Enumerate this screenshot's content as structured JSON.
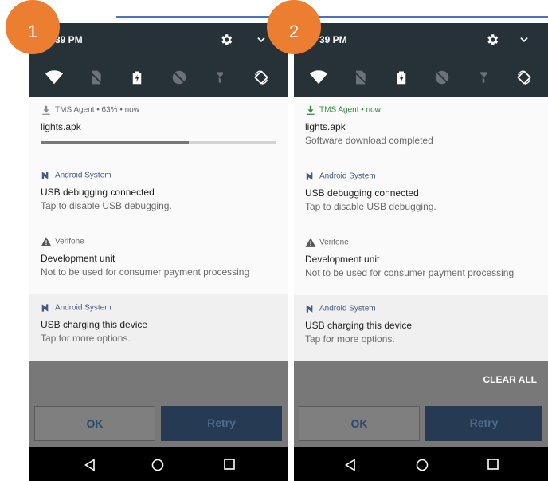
{
  "colors": {
    "statusbar": "#263238",
    "badge": "#ec7e32",
    "notification_bg": "#fafafa",
    "scrim": "#787878",
    "retry_button": "#263a53",
    "tms_download_green": "#2e8b3a"
  },
  "panels": [
    {
      "badge": "1",
      "status_time": "39 PM",
      "quick_settings_icons": [
        "wifi-icon",
        "sim-off-icon",
        "battery-icon",
        "data-saver-icon",
        "flashlight-off-icon",
        "auto-rotate-icon"
      ],
      "notifications": [
        {
          "app_icon": "download-icon",
          "app_line": "TMS Agent • 63% • now",
          "title": "lights.apk",
          "progress_percent": 63
        },
        {
          "app_icon": "android-n-icon",
          "app_line": "Android System",
          "title": "USB debugging connected",
          "subtitle": "Tap to disable USB debugging."
        },
        {
          "app_icon": "warning-icon",
          "app_line": "Verifone",
          "title": "Development unit",
          "subtitle": "Not to be used for consumer payment processing"
        },
        {
          "app_icon": "android-n-icon",
          "app_line": "Android System",
          "title": "USB charging this device",
          "subtitle": "Tap for more options."
        }
      ],
      "buttons": {
        "ok": "OK",
        "retry": "Retry"
      }
    },
    {
      "badge": "2",
      "status_time": "39 PM",
      "quick_settings_icons": [
        "wifi-icon",
        "sim-off-icon",
        "battery-icon",
        "data-saver-icon",
        "flashlight-off-icon",
        "auto-rotate-icon"
      ],
      "notifications": [
        {
          "app_icon": "download-icon",
          "app_line": "TMS Agent • now",
          "title": "lights.apk",
          "subtitle": "Software download completed"
        },
        {
          "app_icon": "android-n-icon",
          "app_line": "Android System",
          "title": "USB debugging connected",
          "subtitle": "Tap to disable USB debugging."
        },
        {
          "app_icon": "warning-icon",
          "app_line": "Verifone",
          "title": "Development unit",
          "subtitle": "Not to be used for consumer payment processing"
        },
        {
          "app_icon": "android-n-icon",
          "app_line": "Android System",
          "title": "USB charging this device",
          "subtitle": "Tap for more options."
        }
      ],
      "clear_all": "CLEAR ALL",
      "buttons": {
        "ok": "OK",
        "retry": "Retry"
      }
    }
  ]
}
